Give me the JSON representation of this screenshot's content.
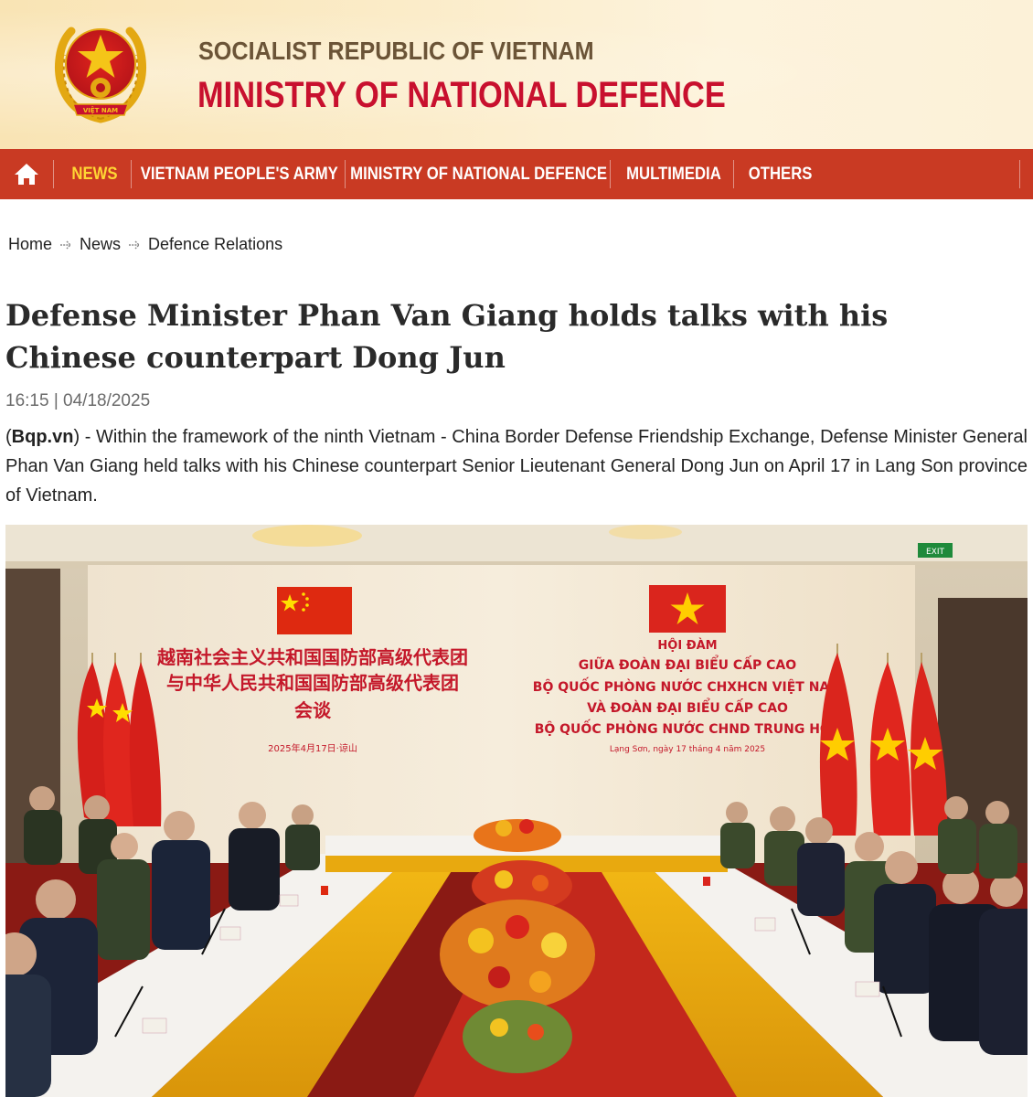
{
  "header": {
    "line1": "SOCIALIST REPUBLIC OF VIETNAM",
    "line2": "MINISTRY OF NATIONAL DEFENCE",
    "emblem_text": "VIỆT NAM",
    "colors": {
      "red": "#c8102e",
      "gold": "#f0c419",
      "brown": "#6b5437"
    }
  },
  "nav": {
    "home_icon": "home-icon",
    "items": [
      {
        "label": "NEWS",
        "active": true
      },
      {
        "label": "VIETNAM PEOPLE'S ARMY"
      },
      {
        "label": "MINISTRY OF NATIONAL DEFENCE"
      },
      {
        "label": "MULTIMEDIA"
      },
      {
        "label": "OTHERS"
      }
    ],
    "colors": {
      "background": "#c93a23",
      "active": "#ffd634"
    }
  },
  "breadcrumb": [
    "Home",
    "News",
    "Defence Relations"
  ],
  "article": {
    "title": "Defense Minister Phan Van Giang holds talks with his Chinese counterpart Dong Jun",
    "time": "16:15 | 04/18/2025",
    "source": "Bqp.vn",
    "lead_open": "(",
    "lead_rest": ") - Within the framework of the ninth Vietnam - China Border Defense Friendship Exchange, Defense Minister General Phan Van Giang held talks with his Chinese counterpart Senior Lieutenant General Dong Jun on April 17 in Lang Son province of Vietnam."
  },
  "photo": {
    "banner_cn": [
      "越南社会主义共和国国防部高级代表团",
      "与中华人民共和国国防部高级代表团",
      "会谈"
    ],
    "banner_cn_date": "2025年4月17日·谅山",
    "banner_vn": [
      "HỘI ĐÀM",
      "GIỮA ĐOÀN ĐẠI BIỂU CẤP CAO",
      "BỘ QUỐC PHÒNG NƯỚC CHXHCN VIỆT NAM",
      "VÀ ĐOÀN ĐẠI BIỂU CẤP CAO",
      "BỘ QUỐC PHÒNG NƯỚC CHND TRUNG HOA"
    ],
    "banner_vn_date": "Lạng Sơn, ngày 17 tháng 4 năm 2025",
    "exit_sign": "EXIT"
  }
}
